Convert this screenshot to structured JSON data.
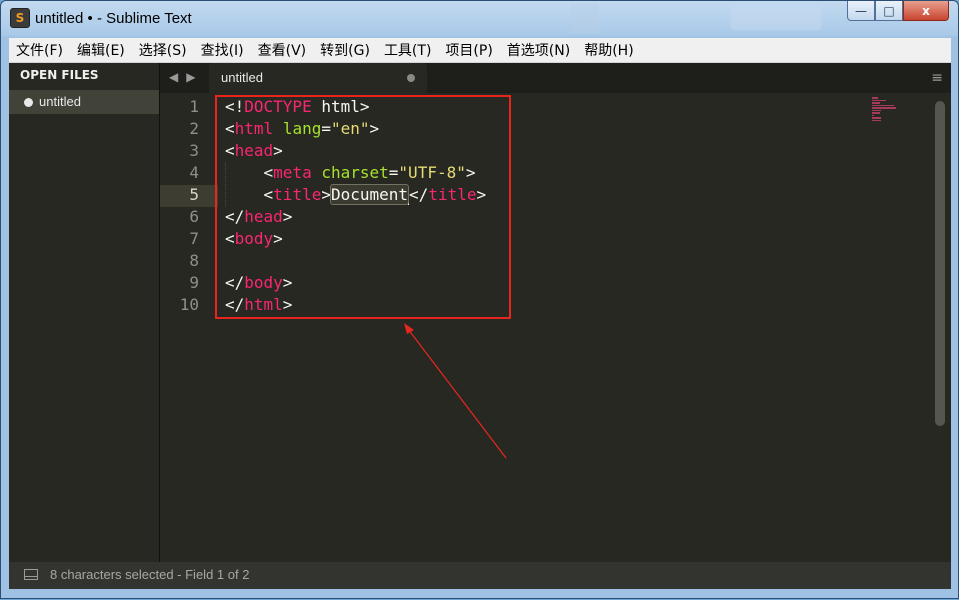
{
  "window": {
    "title": "untitled • - Sublime Text",
    "app_icon": "S",
    "buttons": {
      "minimize": "—",
      "maximize": "□",
      "close": "x"
    }
  },
  "menu": [
    "文件(F)",
    "编辑(E)",
    "选择(S)",
    "查找(I)",
    "查看(V)",
    "转到(G)",
    "工具(T)",
    "项目(P)",
    "首选项(N)",
    "帮助(H)"
  ],
  "sidebar": {
    "header": "OPEN FILES",
    "files": [
      {
        "label": "untitled"
      }
    ]
  },
  "tabs": [
    {
      "label": "untitled",
      "modified": true
    }
  ],
  "nav": {
    "back": "◀",
    "forward": "▶",
    "tab_menu": "≡"
  },
  "editor": {
    "line_numbers": [
      "1",
      "2",
      "3",
      "4",
      "5",
      "6",
      "7",
      "8",
      "9",
      "10"
    ],
    "active_line": 5,
    "lines": {
      "l1": {
        "a": "<!",
        "b": "DOCTYPE",
        "c": " html>"
      },
      "l2": {
        "a": "<",
        "b": "html",
        "c": " ",
        "d": "lang",
        "e": "=",
        "f": "\"en\"",
        "g": ">"
      },
      "l3": {
        "a": "<",
        "b": "head",
        "c": ">"
      },
      "l4": {
        "a": "    <",
        "b": "meta",
        "c": " ",
        "d": "charset",
        "e": "=",
        "f": "\"UTF-8\"",
        "g": ">"
      },
      "l5": {
        "a": "    <",
        "b": "title",
        "c": ">",
        "d": "Document",
        "e": "</",
        "f": "title",
        "g": ">"
      },
      "l6": {
        "a": "</",
        "b": "head",
        "c": ">"
      },
      "l7": {
        "a": "<",
        "b": "body",
        "c": ">"
      },
      "l8": {
        "a": ""
      },
      "l9": {
        "a": "</",
        "b": "body",
        "c": ">"
      },
      "l10": {
        "a": "</",
        "b": "html",
        "c": ">"
      }
    }
  },
  "status": {
    "icon": "panel-toggle-icon",
    "text": "8 characters selected - Field 1 of 2"
  },
  "colors": {
    "editor_bg": "#272822",
    "tag": "#f92672",
    "attribute": "#a6e22e",
    "string": "#e6db74",
    "annotation": "#e8261e"
  }
}
